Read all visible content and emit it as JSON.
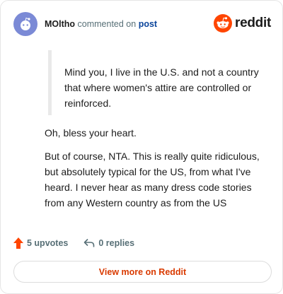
{
  "header": {
    "username": "MOltho",
    "action": "commented on",
    "post_link": "post",
    "logo_text": "reddit"
  },
  "comment": {
    "quote": "Mind you, I live in the U.S. and not a country that where women's attire are controlled or reinforced.",
    "paragraphs": [
      "Oh, bless your heart.",
      "But of course, NTA. This is really quite ridiculous, but absolutely typical for the US, from what I've heard. I never hear as many dress code stories from any Western country as from the US"
    ]
  },
  "footer": {
    "upvotes": "5 upvotes",
    "replies": "0 replies"
  },
  "view_more": "View more on Reddit",
  "colors": {
    "brand": "#ff4500",
    "link": "#0a449b",
    "button_text": "#d93a00",
    "upvote": "#ff4500",
    "avatar": "#7b8ad6"
  },
  "icons": {
    "avatar": "snoo-avatar-icon",
    "logo": "reddit-snoo-icon",
    "upvote": "upvote-arrow-icon",
    "reply": "reply-arrow-icon"
  }
}
